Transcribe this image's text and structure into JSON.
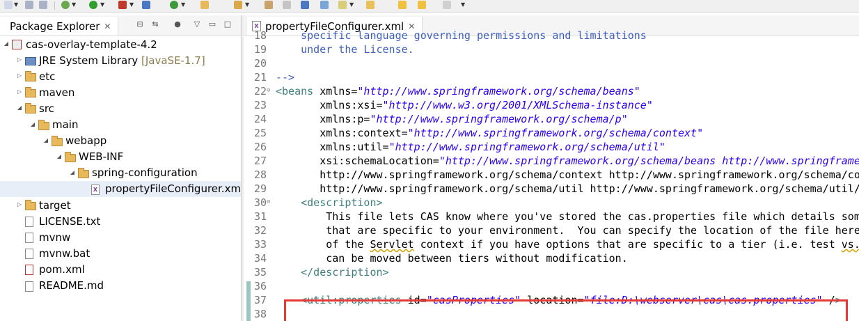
{
  "explorer": {
    "tab_label": "Package Explorer",
    "tree": [
      {
        "label": "cas-overlay-template-4.2",
        "depth": 0,
        "expanded": true,
        "icon": "maven-project-icon"
      },
      {
        "label": "JRE System Library",
        "suffix": "[JavaSE-1.7]",
        "depth": 1,
        "expanded": false,
        "icon": "library-icon"
      },
      {
        "label": "etc",
        "depth": 1,
        "expanded": false,
        "icon": "folder-icon"
      },
      {
        "label": "maven",
        "depth": 1,
        "expanded": false,
        "icon": "folder-icon"
      },
      {
        "label": "src",
        "depth": 1,
        "expanded": true,
        "icon": "folder-icon"
      },
      {
        "label": "main",
        "depth": 2,
        "expanded": true,
        "icon": "folder-icon"
      },
      {
        "label": "webapp",
        "depth": 3,
        "expanded": true,
        "icon": "folder-icon"
      },
      {
        "label": "WEB-INF",
        "depth": 4,
        "expanded": true,
        "icon": "folder-icon"
      },
      {
        "label": "spring-configuration",
        "depth": 5,
        "expanded": true,
        "icon": "folder-icon"
      },
      {
        "label": "propertyFileConfigurer.xm",
        "depth": 6,
        "icon": "xml-file-icon",
        "selected": true
      },
      {
        "label": "target",
        "depth": 1,
        "expanded": false,
        "icon": "folder-icon"
      },
      {
        "label": "LICENSE.txt",
        "depth": 1,
        "icon": "text-file-icon"
      },
      {
        "label": "mvnw",
        "depth": 1,
        "icon": "text-file-icon"
      },
      {
        "label": "mvnw.bat",
        "depth": 1,
        "icon": "text-file-icon"
      },
      {
        "label": "pom.xml",
        "depth": 1,
        "icon": "pom-file-icon"
      },
      {
        "label": "README.md",
        "depth": 1,
        "icon": "markdown-file-icon"
      }
    ]
  },
  "editor": {
    "tab_label": "propertyFileConfigurer.xml",
    "lines": [
      {
        "n": "18",
        "t": "    specific language governing permissions and limitations"
      },
      {
        "n": "19",
        "t": "    under the License."
      },
      {
        "n": "20",
        "t": ""
      },
      {
        "n": "21",
        "t": "-->"
      },
      {
        "n": "22",
        "t": "<beans xmlns=\"http://www.springframework.org/schema/beans\""
      },
      {
        "n": "23",
        "t": "       xmlns:xsi=\"http://www.w3.org/2001/XMLSchema-instance\""
      },
      {
        "n": "24",
        "t": "       xmlns:p=\"http://www.springframework.org/schema/p\""
      },
      {
        "n": "25",
        "t": "       xmlns:context=\"http://www.springframework.org/schema/context\""
      },
      {
        "n": "26",
        "t": "       xmlns:util=\"http://www.springframework.org/schema/util\""
      },
      {
        "n": "27",
        "t": "       xsi:schemaLocation=\"http://www.springframework.org/schema/beans http://www.springframew"
      },
      {
        "n": "28",
        "t": "       http://www.springframework.org/schema/context http://www.springframework.org/schema/con"
      },
      {
        "n": "29",
        "t": "       http://www.springframework.org/schema/util http://www.springframework.org/schema/util/"
      },
      {
        "n": "30",
        "t": "    <description>"
      },
      {
        "n": "31",
        "t": "        This file lets CAS know where you've stored the cas.properties file which details some"
      },
      {
        "n": "32",
        "t": "        that are specific to your environment.  You can specify the location of the file here"
      },
      {
        "n": "33",
        "t": "        of the Servlet context if you have options that are specific to a tier (i.e. test vs."
      },
      {
        "n": "34",
        "t": "        can be moved between tiers without modification."
      },
      {
        "n": "35",
        "t": "    </description>"
      },
      {
        "n": "36",
        "t": ""
      },
      {
        "n": "37",
        "t": "    <util:properties id=\"casProperties\" location=\"file:D:\\webserver\\cas\\cas.properties\" />"
      },
      {
        "n": "38",
        "t": ""
      }
    ]
  }
}
